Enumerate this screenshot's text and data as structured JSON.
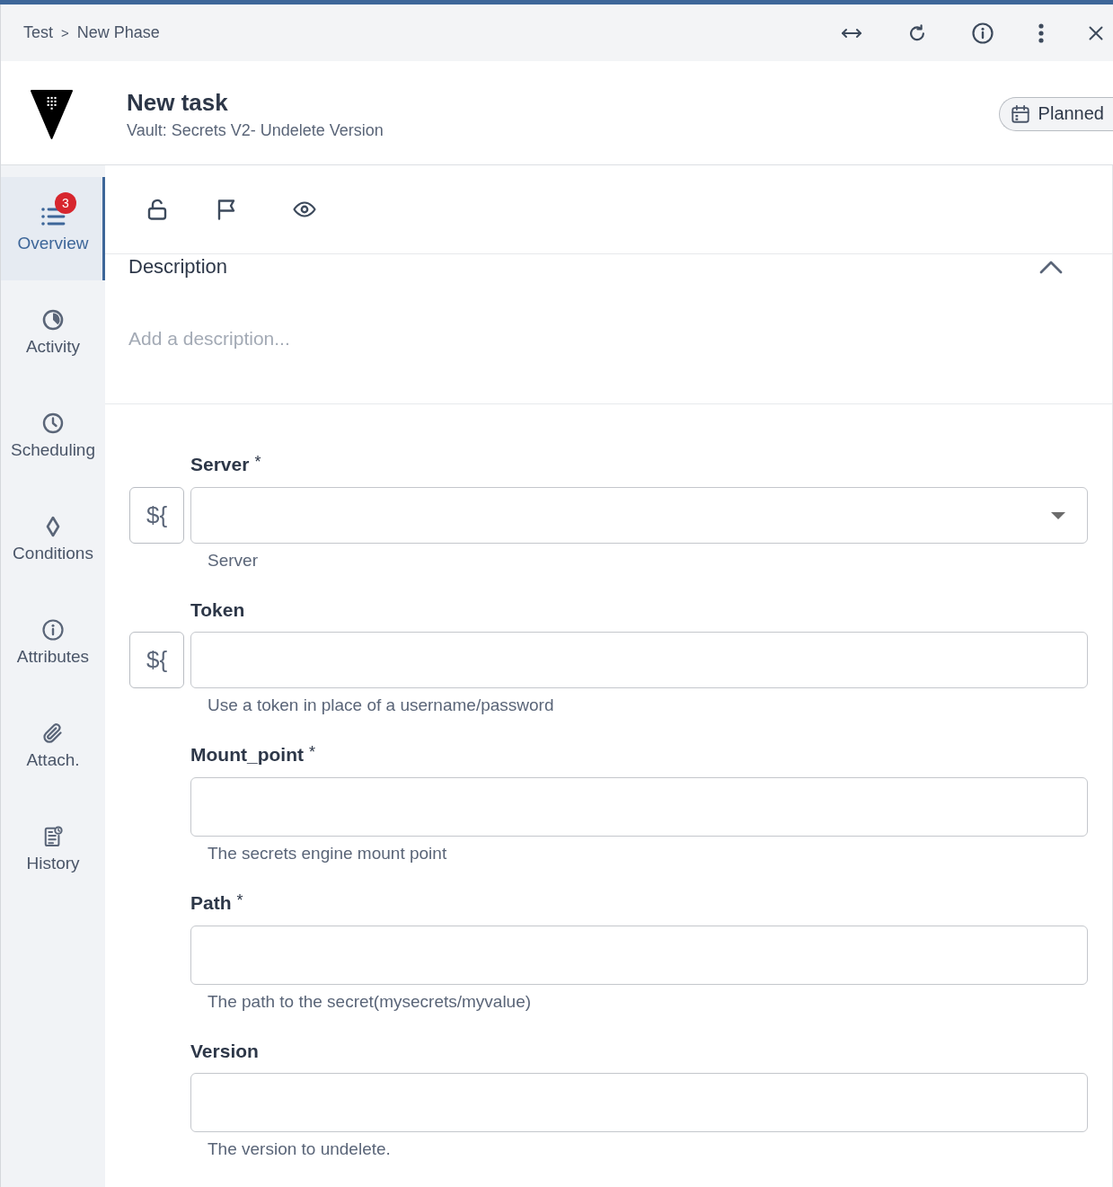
{
  "breadcrumb": {
    "items": [
      {
        "label": "Test"
      },
      {
        "label": "New Phase"
      }
    ],
    "separator": ">"
  },
  "task": {
    "title": "New task",
    "subtitle": "Vault: Secrets V2- Undelete Version",
    "status": "Planned"
  },
  "sidebar": {
    "items": [
      {
        "label": "Overview",
        "selected": true,
        "badge": "3"
      },
      {
        "label": "Activity",
        "selected": false
      },
      {
        "label": "Scheduling",
        "selected": false
      },
      {
        "label": "Conditions",
        "selected": false
      },
      {
        "label": "Attributes",
        "selected": false
      },
      {
        "label": "Attach.",
        "selected": false
      },
      {
        "label": "History",
        "selected": false
      }
    ]
  },
  "description": {
    "title": "Description",
    "expanded": true,
    "placeholder": "Add a description..."
  },
  "form": {
    "required_mark": "*",
    "fields": [
      {
        "kind": "select",
        "label": "Server",
        "required": true,
        "variable_button": "${",
        "help": "Server"
      },
      {
        "kind": "text",
        "label": "Token",
        "required": false,
        "variable_button": "${",
        "help": "Use a token in place of a username/password"
      },
      {
        "kind": "text",
        "label": "Mount_point",
        "required": true,
        "help": "The secrets engine mount point"
      },
      {
        "kind": "text",
        "label": "Path",
        "required": true,
        "help": "The path to the secret(mysecrets/myvalue)"
      },
      {
        "kind": "text",
        "label": "Version",
        "required": false,
        "help": "The version to undelete."
      }
    ]
  }
}
